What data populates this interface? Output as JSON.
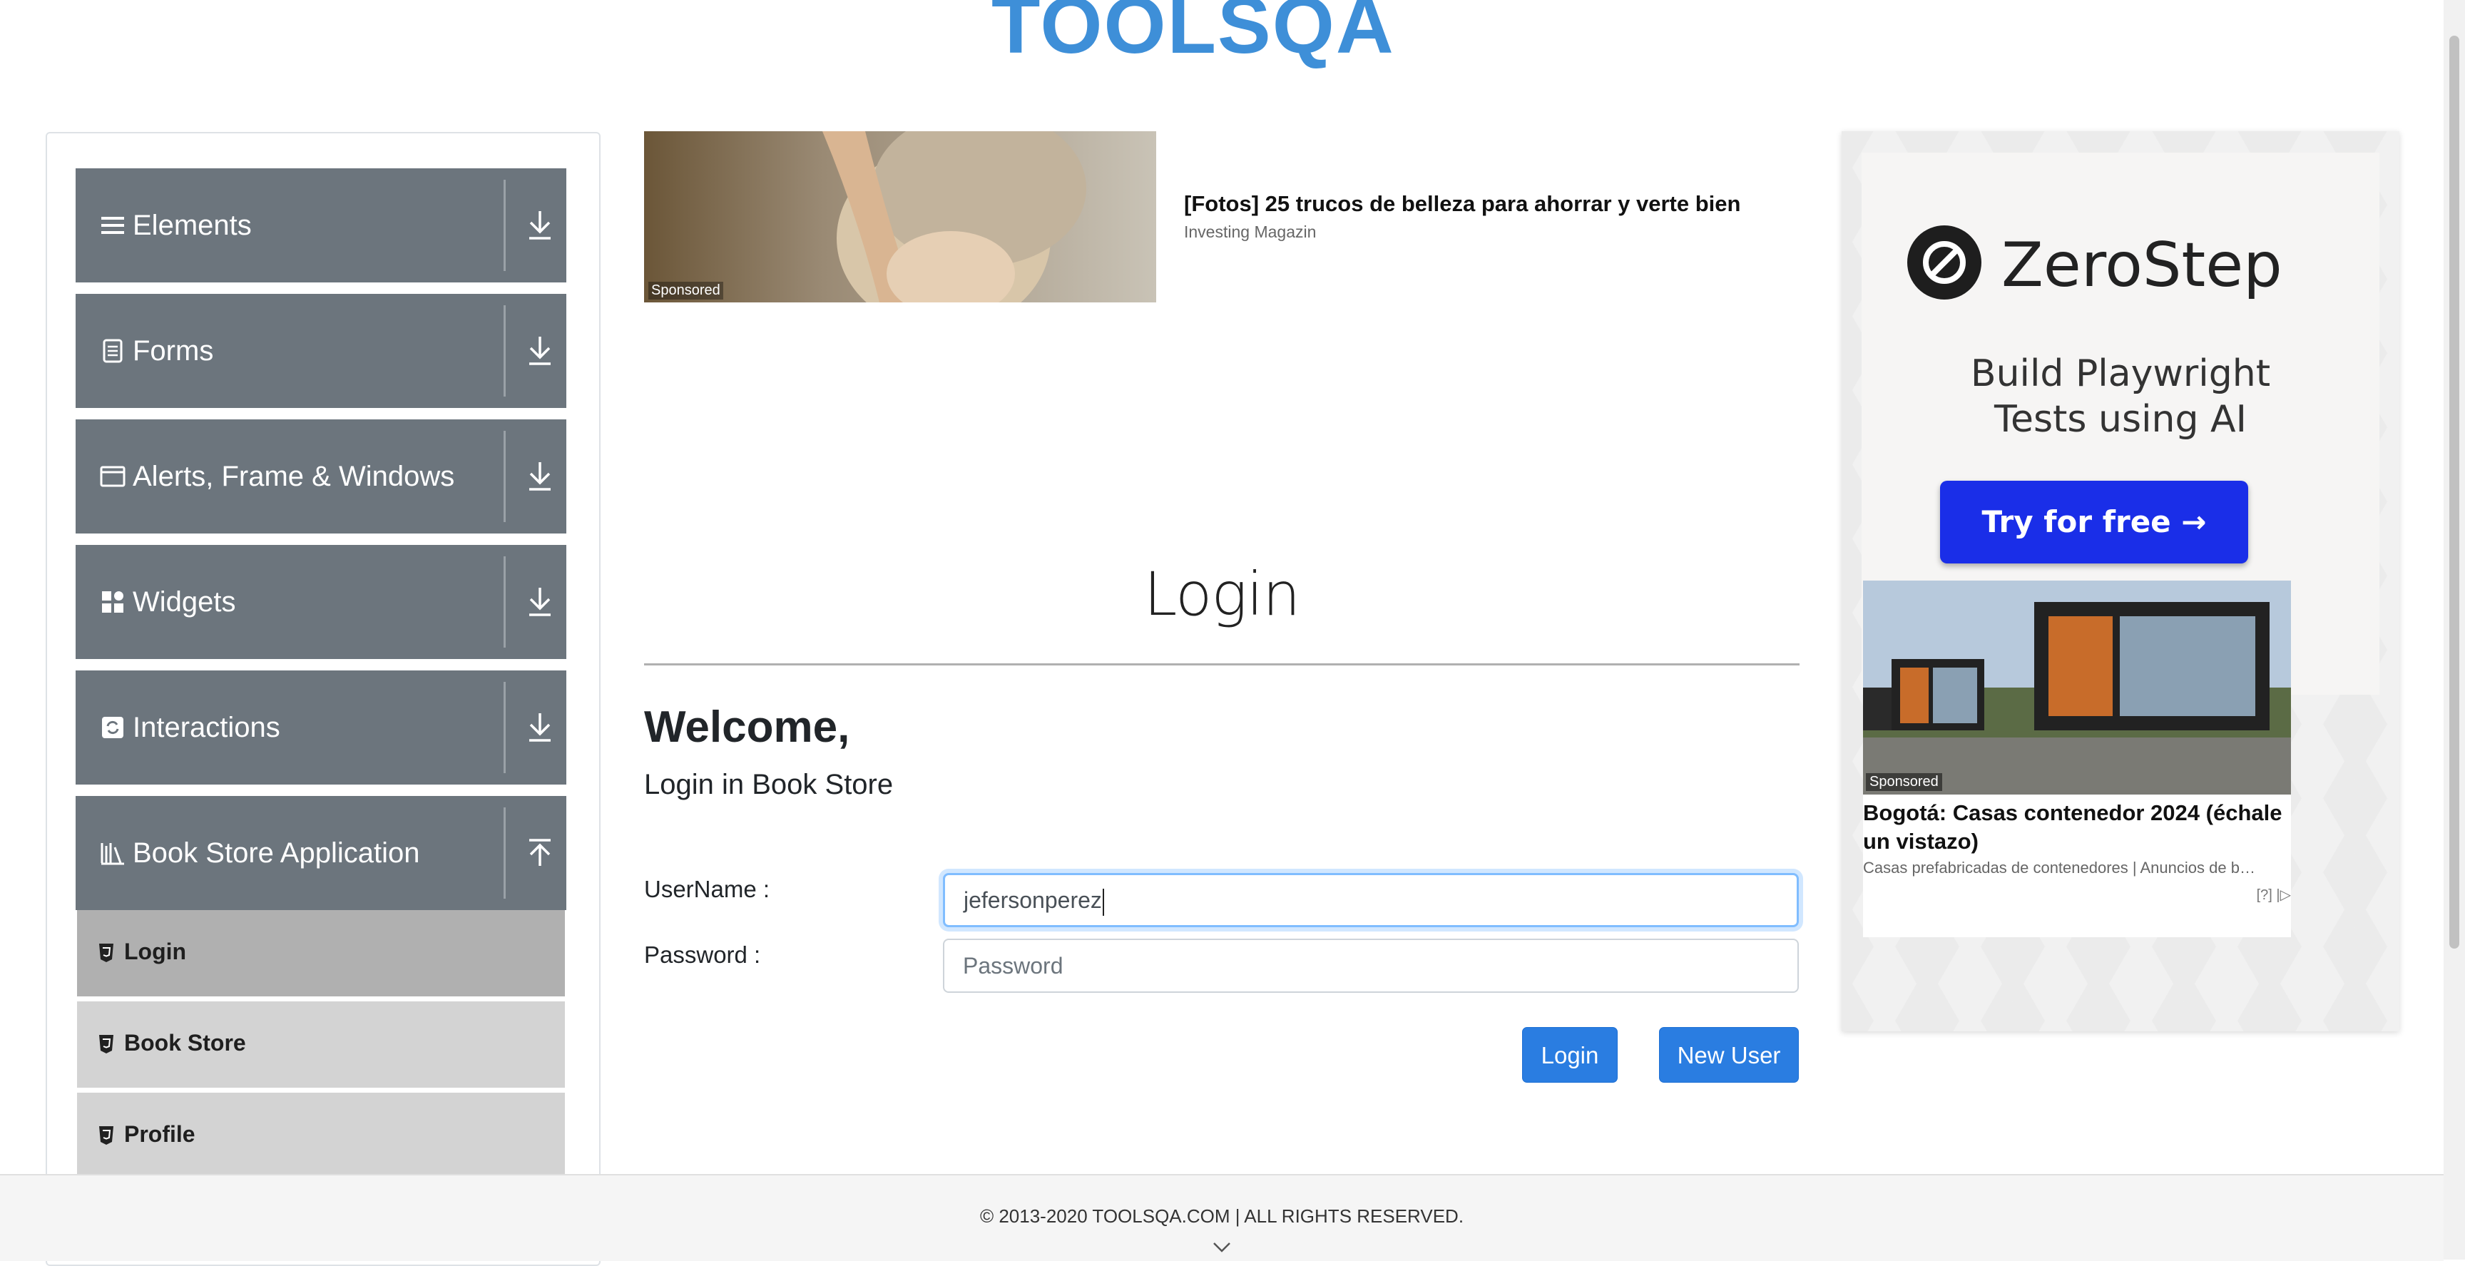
{
  "header": {
    "logo_text": "TOOLSQA"
  },
  "sidebar": {
    "groups": [
      {
        "label": "Elements",
        "icon": "hamburger-icon"
      },
      {
        "label": "Forms",
        "icon": "document-icon"
      },
      {
        "label": "Alerts, Frame & Windows",
        "icon": "window-icon"
      },
      {
        "label": "Widgets",
        "icon": "grid-icon"
      },
      {
        "label": "Interactions",
        "icon": "refresh-icon"
      },
      {
        "label": "Book Store Application",
        "icon": "books-icon"
      }
    ],
    "items": [
      {
        "label": "Login",
        "active": true
      },
      {
        "label": "Book Store"
      },
      {
        "label": "Profile"
      }
    ]
  },
  "ad_top": {
    "sponsored": "Sponsored",
    "title": "[Fotos] 25 trucos de belleza para ahorrar y verte bien",
    "source": "Investing Magazin"
  },
  "main": {
    "header": "Login",
    "welcome": "Welcome,",
    "subtitle": "Login in Book Store",
    "username_label": "UserName :",
    "username_value": "jefersonperez",
    "password_label": "Password :",
    "password_placeholder": "Password",
    "login_button": "Login",
    "new_user_button": "New User"
  },
  "ad_right": {
    "brand": "ZeroStep",
    "tagline_line1": "Build Playwright",
    "tagline_line2": "Tests using AI",
    "cta": "Try for free →",
    "close": "✕",
    "ad2_sponsored": "Sponsored",
    "ad2_title": "Bogotá: Casas contenedor 2024 (échale un vistazo)",
    "ad2_sub": "Casas prefabricadas de contenedores | Anuncios de b…",
    "ad2_choices": "[?] |▷"
  },
  "footer": {
    "text": "© 2013-2020 TOOLSQA.COM | ALL RIGHTS RESERVED."
  },
  "colors": {
    "sidebar_group": "#6c757d",
    "primary_button": "#2a7de1",
    "zerostep_button": "#1a2ee8",
    "logo_blue": "#3e8fd8",
    "logo_dark": "#2f3a45"
  }
}
